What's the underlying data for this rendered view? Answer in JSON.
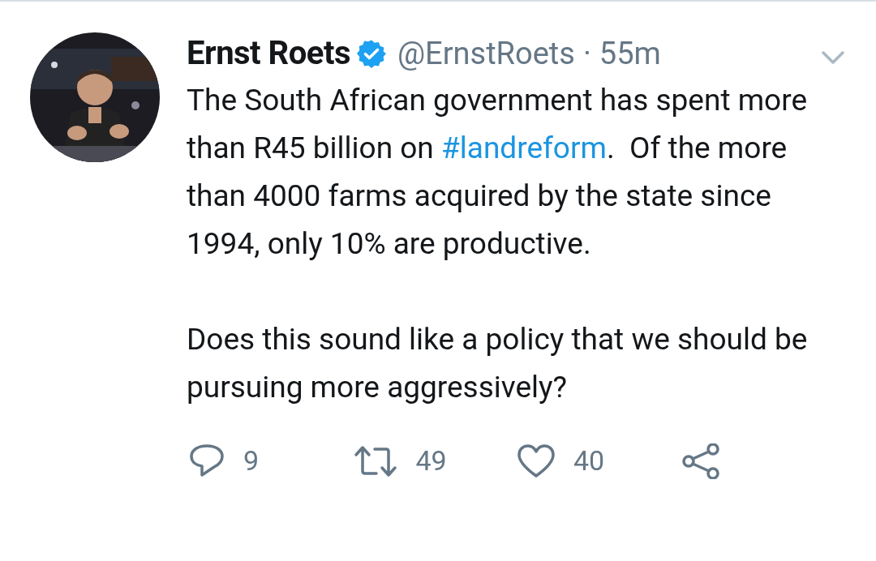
{
  "tweet": {
    "name": "Ernst Roets",
    "verified": true,
    "handle": "@ErnstRoets",
    "separator": "·",
    "time": "55m",
    "paragraphs": [
      [
        {
          "kind": "text",
          "text": "The South African government has spent more than R45 billion on "
        },
        {
          "kind": "hashtag",
          "text": "#landreform"
        },
        {
          "kind": "text",
          "text": ".  Of the more than 4000 farms acquired by the state since 1994, only 10% are productive."
        }
      ],
      [
        {
          "kind": "text",
          "text": "Does this sound like a policy that we should be pursuing more aggressively?"
        }
      ]
    ],
    "actions": [
      {
        "kind": "reply",
        "count": "9"
      },
      {
        "kind": "retweet",
        "count": "49"
      },
      {
        "kind": "like",
        "count": "40"
      },
      {
        "kind": "share"
      }
    ]
  }
}
